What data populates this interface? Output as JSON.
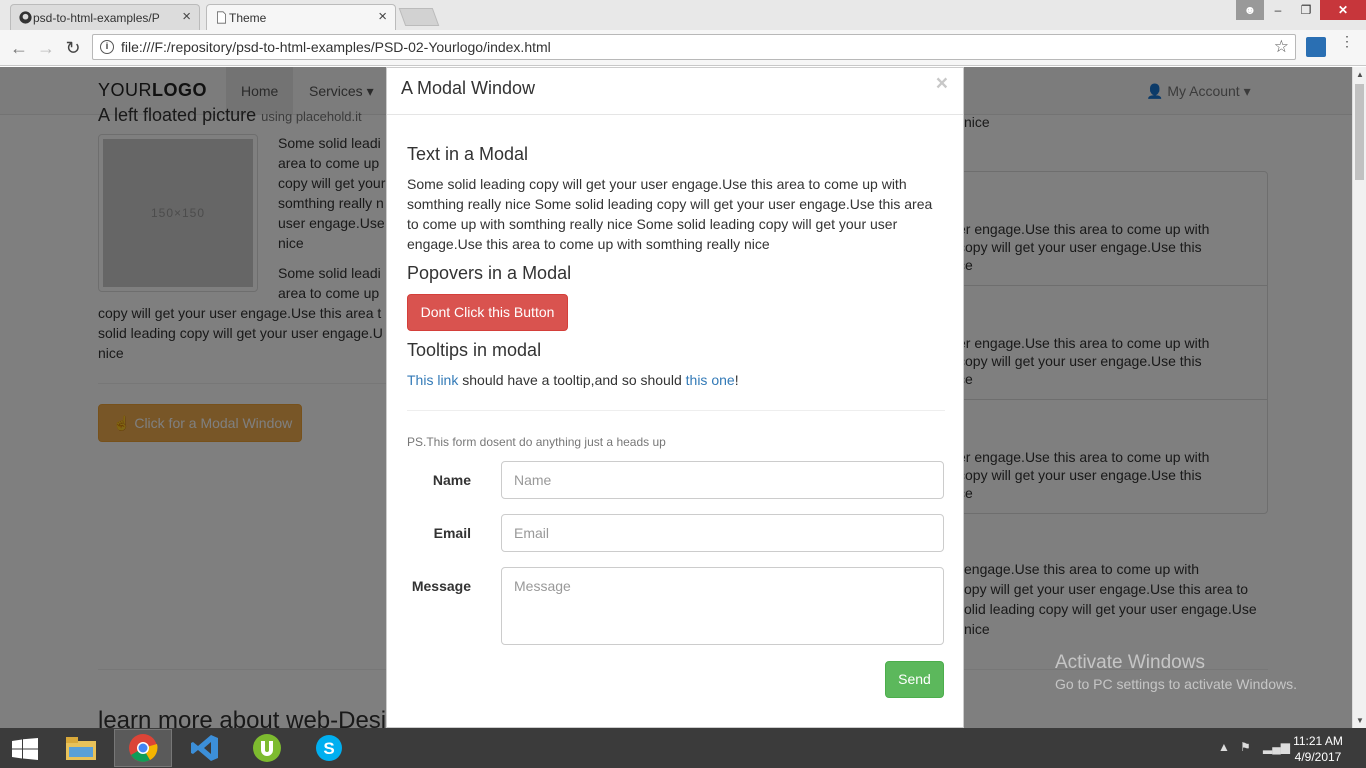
{
  "browser": {
    "tabs": [
      {
        "label": "psd-to-html-examples/P",
        "icon": "github-icon"
      },
      {
        "label": "Theme",
        "icon": "page-icon"
      }
    ],
    "url": "file:///F:/repository/psd-to-html-examples/PSD-02-Yourlogo/index.html"
  },
  "site": {
    "brand_light": "YOUR",
    "brand_bold": "LOGO",
    "nav": [
      {
        "label": "Home",
        "active": true
      },
      {
        "label": "Services ▾"
      }
    ],
    "account": "My Account ▾",
    "heading_partial": "A left floated picture",
    "heading_small": "using placehold.it",
    "thumb_label": "150×150",
    "bg_para1": [
      "Some solid leadi",
      "area to come up",
      "copy will get your",
      "somthing really n",
      "user engage.Use",
      "nice"
    ],
    "bg_para2": [
      "Some solid leadi",
      "area to come up"
    ],
    "bg_para2_full": [
      "copy will get your user engage.Use this area t",
      "solid leading copy will get your user engage.U",
      "nice"
    ],
    "modal_button": "Click for a Modal Window",
    "right_top_text": "nice",
    "panel_rows": [
      [
        "er engage.Use this area to come up with",
        "copy will get your user engage.Use this",
        "ce"
      ],
      [
        "er engage.Use this area to come up with",
        "copy will get your user engage.Use this",
        "ce"
      ],
      [
        "er engage.Use this area to come up with",
        "copy will get your user engage.Use this",
        "ce"
      ]
    ],
    "right_bottom": [
      "engage.Use this area to come up with",
      "opy will get your user engage.Use this area to",
      "olid leading copy will get your user engage.Use",
      "nice"
    ],
    "learn_more": "learn more about web-Desi"
  },
  "watermark": {
    "line1": "Activate Windows",
    "line2": "Go to PC settings to activate Windows."
  },
  "modal": {
    "title": "A Modal Window",
    "close": "×",
    "text_heading": "Text in a Modal",
    "text_body": "Some solid leading copy will get your user engage.Use this area to come up with somthing really nice Some solid leading copy will get your user engage.Use this area to come up with somthing really nice Some solid leading copy will get your user engage.Use this area to come up with somthing really nice",
    "popover_heading": "Popovers in a Modal",
    "danger_button": "Dont Click this Button",
    "tooltip_heading": "Tooltips in modal",
    "tooltip_link1": "This link",
    "tooltip_mid": " should have a tooltip,and so should ",
    "tooltip_link2": "this one",
    "tooltip_end": "!",
    "ps_note": "PS.This form dosent do anything just a heads up",
    "form": {
      "name_label": "Name",
      "name_placeholder": "Name",
      "email_label": "Email",
      "email_placeholder": "Email",
      "message_label": "Message",
      "message_placeholder": "Message",
      "send": "Send"
    }
  },
  "taskbar": {
    "apps": [
      "file-explorer-icon",
      "chrome-icon",
      "visual-studio-icon",
      "utorrent-icon",
      "skype-icon"
    ],
    "time": "11:21 AM",
    "date": "4/9/2017"
  },
  "colors": {
    "danger": "#d9534f",
    "success": "#5cb85c",
    "warning": "#f0ad4e",
    "link": "#337ab7"
  }
}
